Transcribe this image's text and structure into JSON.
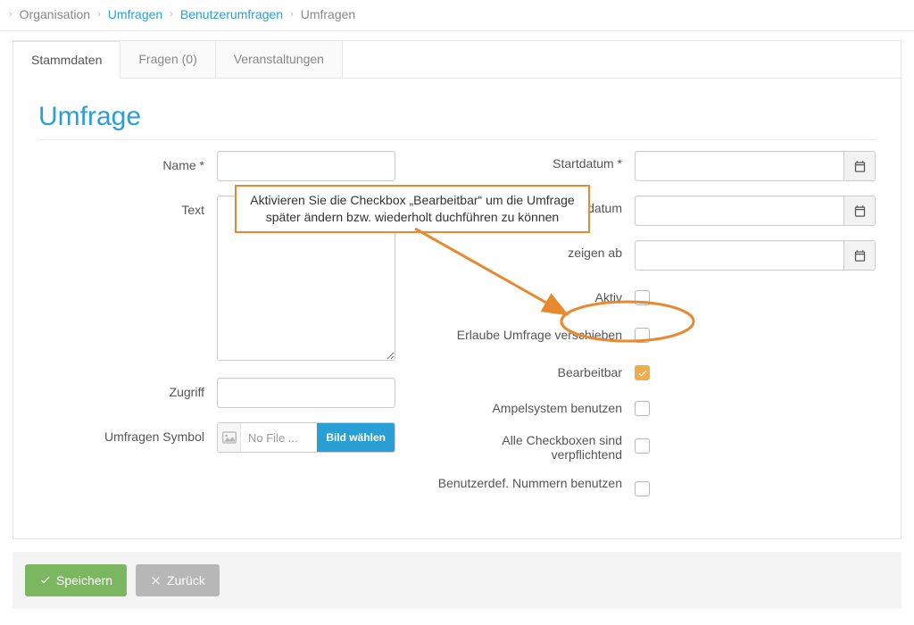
{
  "breadcrumb": {
    "items": [
      {
        "label": "Organisation",
        "link": false
      },
      {
        "label": "Umfragen",
        "link": true
      },
      {
        "label": "Benutzerumfragen",
        "link": true
      },
      {
        "label": "Umfragen",
        "link": false
      }
    ]
  },
  "tabs": [
    {
      "label": "Stammdaten",
      "active": true
    },
    {
      "label": "Fragen (0)",
      "active": false
    },
    {
      "label": "Veranstaltungen",
      "active": false
    }
  ],
  "page": {
    "heading": "Umfrage"
  },
  "form": {
    "left": {
      "name_label": "Name *",
      "name_value": "",
      "text_label": "Text",
      "text_value": "",
      "zugriff_label": "Zugriff",
      "zugriff_value": "",
      "symbol_label": "Umfragen Symbol",
      "file_placeholder": "No File ...",
      "file_button": "Bild wählen"
    },
    "right": {
      "start_label": "Startdatum *",
      "start_value": "",
      "end_label": "Enddatum",
      "end_value": "",
      "show_label": "zeigen ab",
      "show_value": "",
      "aktiv_label": "Aktiv",
      "aktiv_checked": false,
      "verschieben_label": "Erlaube Umfrage verschieben",
      "verschieben_checked": false,
      "bearbeitbar_label": "Bearbeitbar",
      "bearbeitbar_checked": true,
      "ampel_label": "Ampelsystem benutzen",
      "ampel_checked": false,
      "mandatory_label": "Alle Checkboxen sind verpflichtend",
      "mandatory_checked": false,
      "userdef_label": "Benutzerdef. Nummern benutzen",
      "userdef_checked": false
    }
  },
  "annotation": {
    "text": "Aktivieren Sie die Checkbox „Bearbeitbar“ um die Umfrage später ändern bzw. wiederholt duchführen zu können"
  },
  "actions": {
    "save": "Speichern",
    "back": "Zurück"
  },
  "colors": {
    "accent": "#2a9fd6",
    "annotation": "#e8892f",
    "save": "#7bb661",
    "back": "#b7b7b7",
    "checkbox_on": "#f0ad4e"
  }
}
